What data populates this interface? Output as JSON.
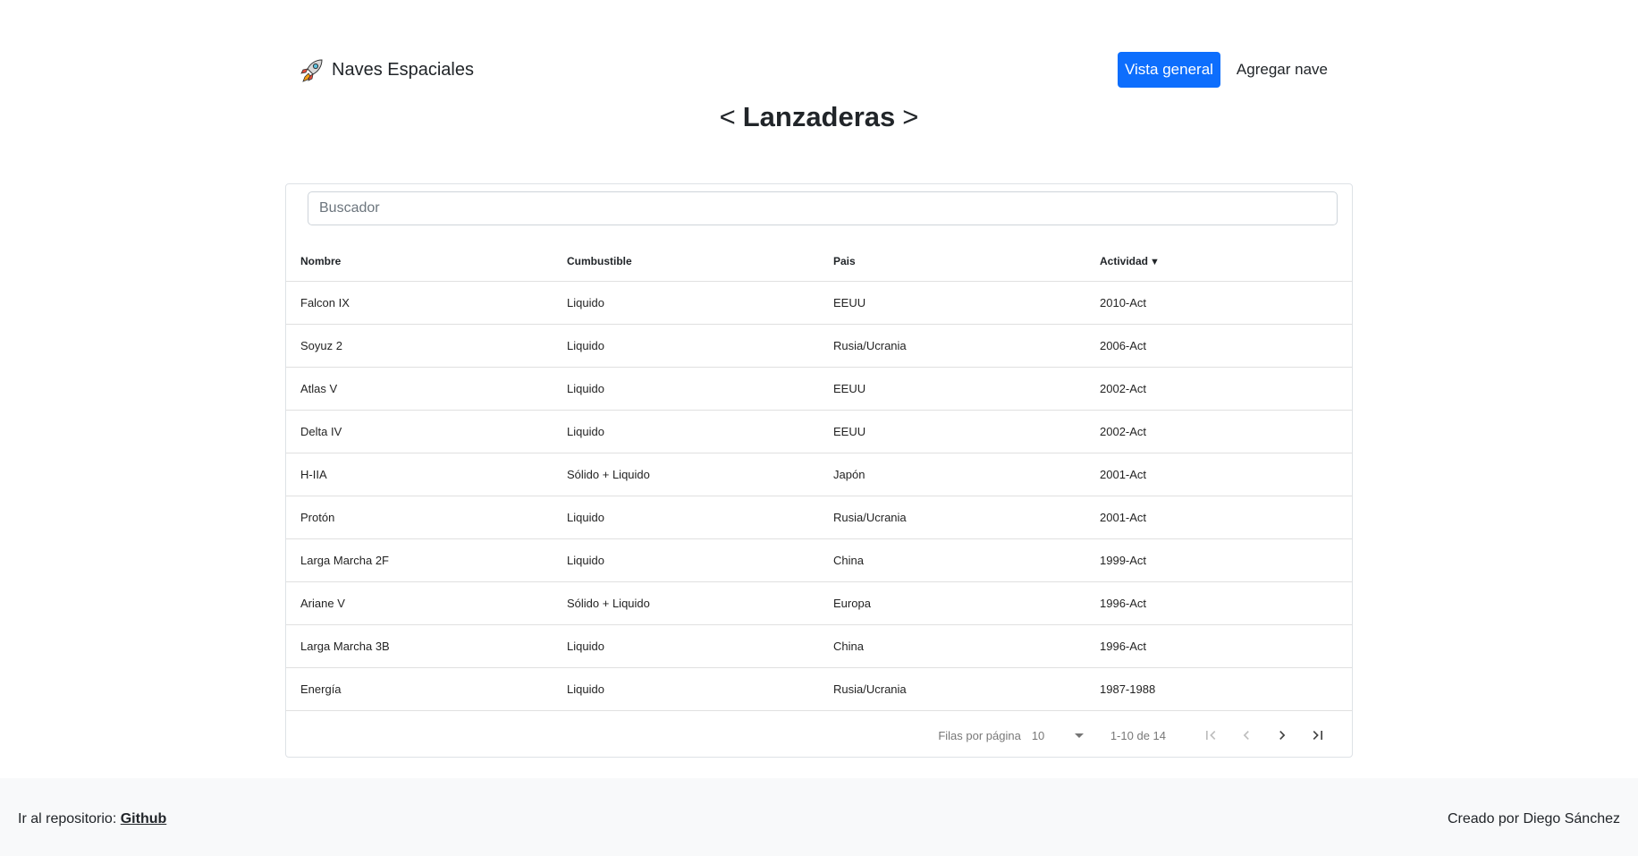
{
  "brand": {
    "name": "Naves Espaciales",
    "icon": "rocket-icon"
  },
  "nav": {
    "overview": "Vista general",
    "add": "Agregar nave"
  },
  "page": {
    "prev": "<",
    "title": "Lanzaderas",
    "next": ">"
  },
  "search": {
    "placeholder": "Buscador"
  },
  "table": {
    "headers": [
      "Nombre",
      "Cumbustible",
      "Pais",
      "Actividad"
    ],
    "sort_indicator": "▼",
    "rows": [
      [
        "Falcon IX",
        "Liquido",
        "EEUU",
        "2010-Act"
      ],
      [
        "Soyuz 2",
        "Liquido",
        "Rusia/Ucrania",
        "2006-Act"
      ],
      [
        "Atlas V",
        "Liquido",
        "EEUU",
        "2002-Act"
      ],
      [
        "Delta IV",
        "Liquido",
        "EEUU",
        "2002-Act"
      ],
      [
        "H-IIA",
        "Sólido + Liquido",
        "Japón",
        "2001-Act"
      ],
      [
        "Protón",
        "Liquido",
        "Rusia/Ucrania",
        "2001-Act"
      ],
      [
        "Larga Marcha 2F",
        "Liquido",
        "China",
        "1999-Act"
      ],
      [
        "Ariane V",
        "Sólido + Liquido",
        "Europa",
        "1996-Act"
      ],
      [
        "Larga Marcha 3B",
        "Liquido",
        "China",
        "1996-Act"
      ],
      [
        "Energía",
        "Liquido",
        "Rusia/Ucrania",
        "1987-1988"
      ]
    ]
  },
  "pagination": {
    "rows_label": "Filas por página",
    "rows_value": "10",
    "range": "1-10 de 14"
  },
  "footer": {
    "repo_label": "Ir al repositorio:",
    "repo_link": "Github",
    "credit": "Creado por Diego Sánchez"
  },
  "colors": {
    "primary": "#0d6efd",
    "footer_bg": "#f8f9fa"
  }
}
